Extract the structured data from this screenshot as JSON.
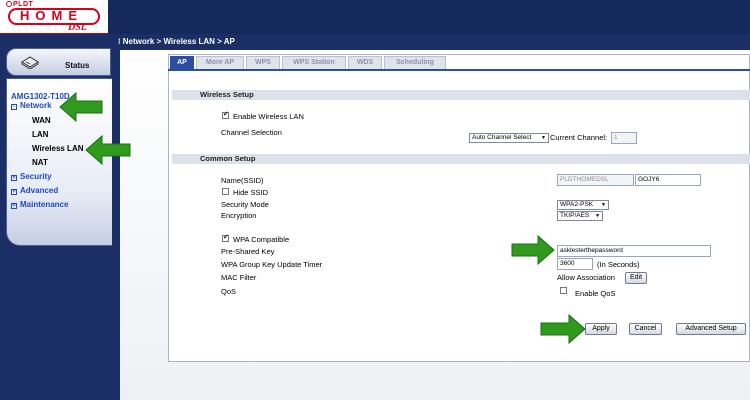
{
  "header": {
    "brand": "PLDT",
    "logo_main": "HOME",
    "logo_sub": "DSL"
  },
  "sidebar": {
    "status_label": "Status",
    "model": "AMG1302-T10D",
    "menu": {
      "network": "Network",
      "wan": "WAN",
      "lan": "LAN",
      "wireless_lan": "Wireless LAN",
      "nat": "NAT",
      "security": "Security",
      "advanced": "Advanced",
      "maintenance": "Maintenance"
    }
  },
  "breadcrumb": "Network > Wireless LAN > AP",
  "tabs": [
    "AP",
    "More AP",
    "WPS",
    "WPS Station",
    "WDS",
    "Scheduling"
  ],
  "wireless_setup": {
    "title": "Wireless Setup",
    "enable_label": "Enable Wireless LAN",
    "enable_checked": true,
    "channel_label": "Channel Selection",
    "channel_value": "Auto Channel Select",
    "current_channel_label": "Current Channel:",
    "current_channel_value": "1"
  },
  "common_setup": {
    "title": "Common Setup",
    "ssid_label": "Name(SSID)",
    "ssid_prefix": "PLDTHOMEDSL",
    "ssid_suffix": "GOJY6",
    "hide_ssid_label": "Hide SSID",
    "security_mode_label": "Security Mode",
    "security_mode_value": "WPA2-PSK",
    "encryption_label": "Encryption",
    "encryption_value": "TKIP/AES",
    "wpa_compatible_label": "WPA Compatible",
    "psk_label": "Pre-Shared Key",
    "psk_value": "asklesterthepassword",
    "group_key_label": "WPA Group Key Update Timer",
    "group_key_value": "3600",
    "group_key_unit": "(In Seconds)",
    "mac_filter_label": "MAC Filter",
    "mac_filter_value": "Allow Association",
    "edit_label": "Edit",
    "qos_label": "QoS",
    "enable_qos_label": "Enable QoS"
  },
  "buttons": {
    "apply": "Apply",
    "cancel": "Cancel",
    "advanced_setup": "Advanced Setup"
  },
  "colors": {
    "page_bg": "#1f3163",
    "accent": "#2b4ea3",
    "link": "#1f48c8",
    "annotation_arrow": "#2f9a1e",
    "brand_red": "#d8001a"
  },
  "icons": {
    "status": "router-icon",
    "arrows": "green-pointer-arrow-icon"
  }
}
